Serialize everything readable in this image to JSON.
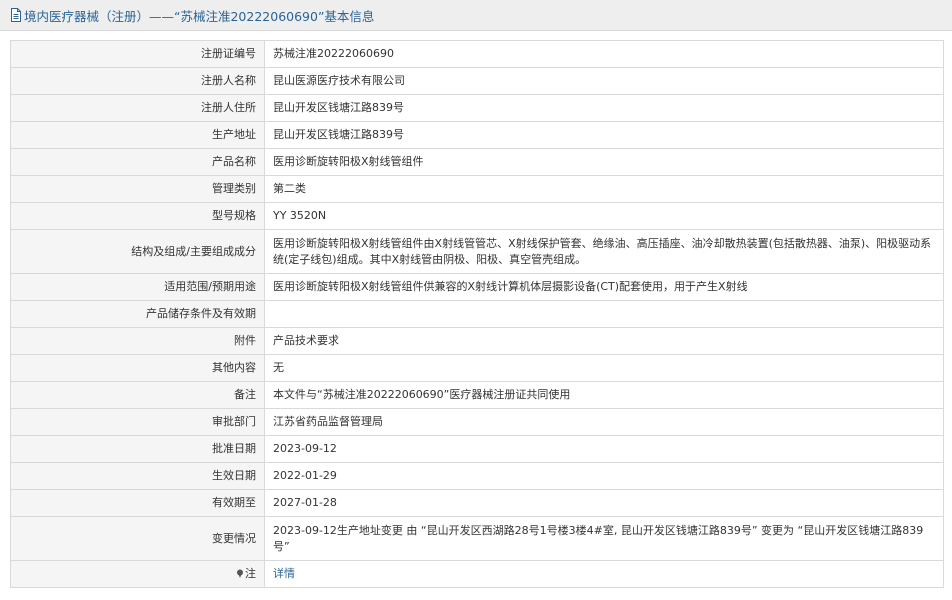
{
  "header": {
    "title": "境内医疗器械（注册）——“苏械注准20222060690”基本信息"
  },
  "rows": [
    {
      "label": "注册证编号",
      "value": "苏械注准20222060690"
    },
    {
      "label": "注册人名称",
      "value": "昆山医源医疗技术有限公司"
    },
    {
      "label": "注册人住所",
      "value": "昆山开发区钱塘江路839号"
    },
    {
      "label": "生产地址",
      "value": "昆山开发区钱塘江路839号"
    },
    {
      "label": "产品名称",
      "value": "医用诊断旋转阳极X射线管组件"
    },
    {
      "label": "管理类别",
      "value": "第二类"
    },
    {
      "label": "型号规格",
      "value": "YY 3520N"
    },
    {
      "label": "结构及组成/主要组成成分",
      "value": "医用诊断旋转阳极X射线管组件由X射线管管芯、X射线保护管套、绝缘油、高压插座、油冷却散热装置(包括散热器、油泵)、阳极驱动系统(定子线包)组成。其中X射线管由阴极、阳极、真空管壳组成。"
    },
    {
      "label": "适用范围/预期用途",
      "value": "医用诊断旋转阳极X射线管组件供兼容的X射线计算机体层摄影设备(CT)配套使用，用于产生X射线"
    },
    {
      "label": "产品储存条件及有效期",
      "value": ""
    },
    {
      "label": "附件",
      "value": "产品技术要求"
    },
    {
      "label": "其他内容",
      "value": "无"
    },
    {
      "label": "备注",
      "value": "本文件与“苏械注准20222060690”医疗器械注册证共同使用"
    },
    {
      "label": "审批部门",
      "value": "江苏省药品监督管理局"
    },
    {
      "label": "批准日期",
      "value": "2023-09-12"
    },
    {
      "label": "生效日期",
      "value": "2022-01-29"
    },
    {
      "label": "有效期至",
      "value": "2027-01-28"
    },
    {
      "label": "变更情况",
      "value": "2023-09-12生产地址变更 由 “昆山开发区西湖路28号1号楼3楼4#室, 昆山开发区钱塘江路839号” 变更为 “昆山开发区钱塘江路839号”"
    }
  ],
  "note": {
    "label": "注",
    "link_text": "详情",
    "icon": "pin-icon"
  },
  "colors": {
    "title_blue": "#2a6496",
    "label_bg": "#f5f5f5",
    "border": "#d9d9d9",
    "header_bg": "#eeeeee"
  }
}
